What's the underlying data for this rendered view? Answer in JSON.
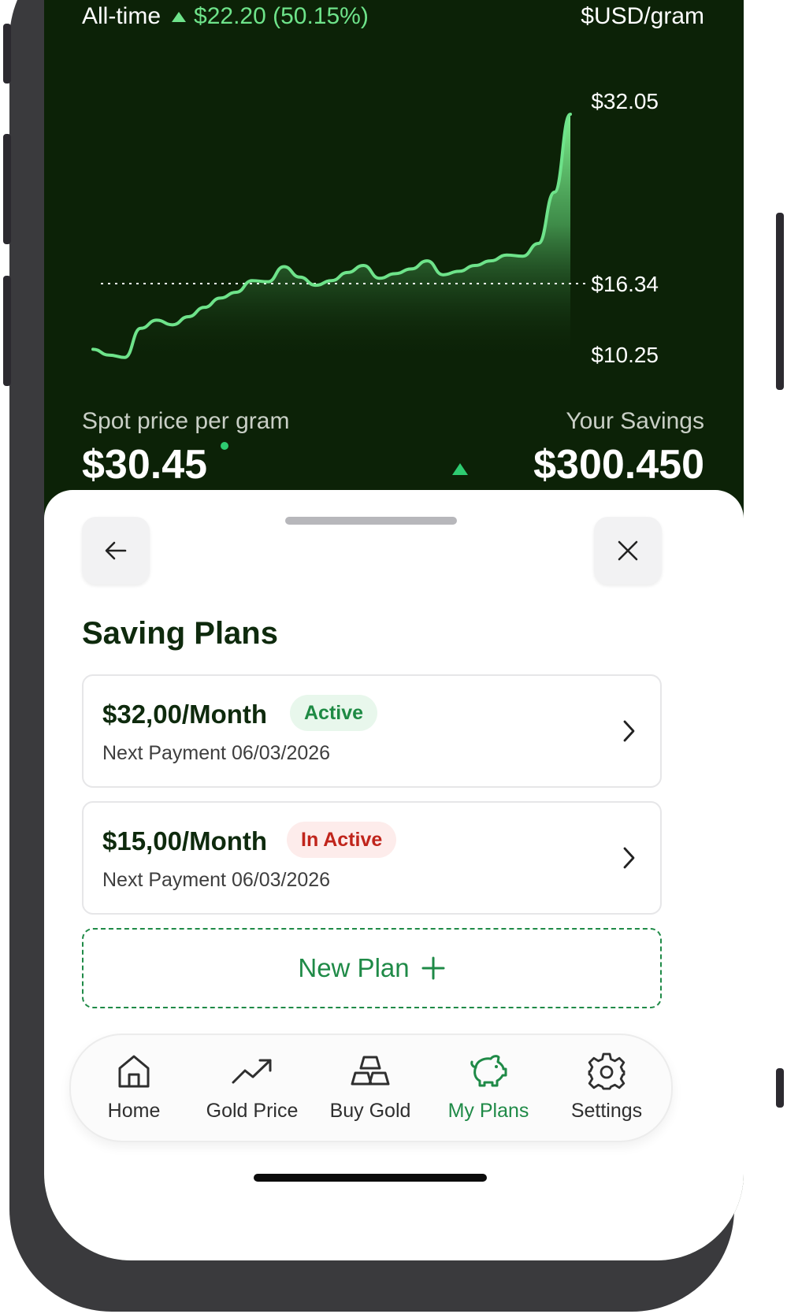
{
  "header": {
    "period_label": "All-time",
    "change_text": "$22.20 (50.15%)",
    "unit_label": "$USD/gram"
  },
  "chart_data": {
    "type": "area",
    "y_labels": [
      "$32.05",
      "$16.34",
      "$10.25"
    ],
    "reference_line": 16.34,
    "ylim": [
      10.25,
      32.05
    ],
    "x": [
      0,
      1,
      2,
      3,
      4,
      5,
      6,
      7,
      8,
      9,
      10,
      11,
      12,
      13,
      14,
      15,
      16,
      17,
      18,
      19,
      20,
      21,
      22,
      23,
      24,
      25,
      26,
      27,
      28,
      29,
      30
    ],
    "values": [
      10.7,
      10.2,
      10.0,
      12.5,
      13.2,
      12.8,
      13.5,
      14.3,
      15.1,
      15.6,
      16.6,
      16.5,
      17.8,
      16.9,
      16.2,
      16.6,
      17.3,
      17.9,
      16.8,
      17.2,
      17.6,
      18.3,
      17.1,
      17.4,
      17.9,
      18.3,
      18.8,
      18.7,
      19.8,
      24.2,
      30.9
    ],
    "colors": {
      "line": "#6ee38a",
      "fill": "#6ee38a",
      "background": "#0c2207"
    }
  },
  "stats": {
    "spot_label": "Spot price per gram",
    "spot_value": "$30.45",
    "savings_label": "Your Savings",
    "savings_value": "$300.450"
  },
  "sheet": {
    "title": "Saving Plans",
    "back_icon": "arrow-left-icon",
    "close_icon": "close-icon",
    "plans": [
      {
        "amount": "$32,00/Month",
        "status": "Active",
        "next_payment": "Next Payment 06/03/2026"
      },
      {
        "amount": "$15,00/Month",
        "status": "In Active",
        "next_payment": "Next Payment 06/03/2026"
      }
    ],
    "new_plan_label": "New Plan"
  },
  "tabs": [
    {
      "label": "Home",
      "icon": "home-icon"
    },
    {
      "label": "Gold Price",
      "icon": "trend-up-icon"
    },
    {
      "label": "Buy Gold",
      "icon": "gold-bars-icon"
    },
    {
      "label": "My Plans",
      "icon": "piggy-bank-icon",
      "active": true
    },
    {
      "label": "Settings",
      "icon": "gear-icon"
    }
  ],
  "colors": {
    "accent": "#1f8a47",
    "header_bg": "#0c2207",
    "active_badge_bg": "#e8f7ec",
    "inactive_badge_bg": "#fdeceb",
    "inactive_text": "#c0251c"
  }
}
